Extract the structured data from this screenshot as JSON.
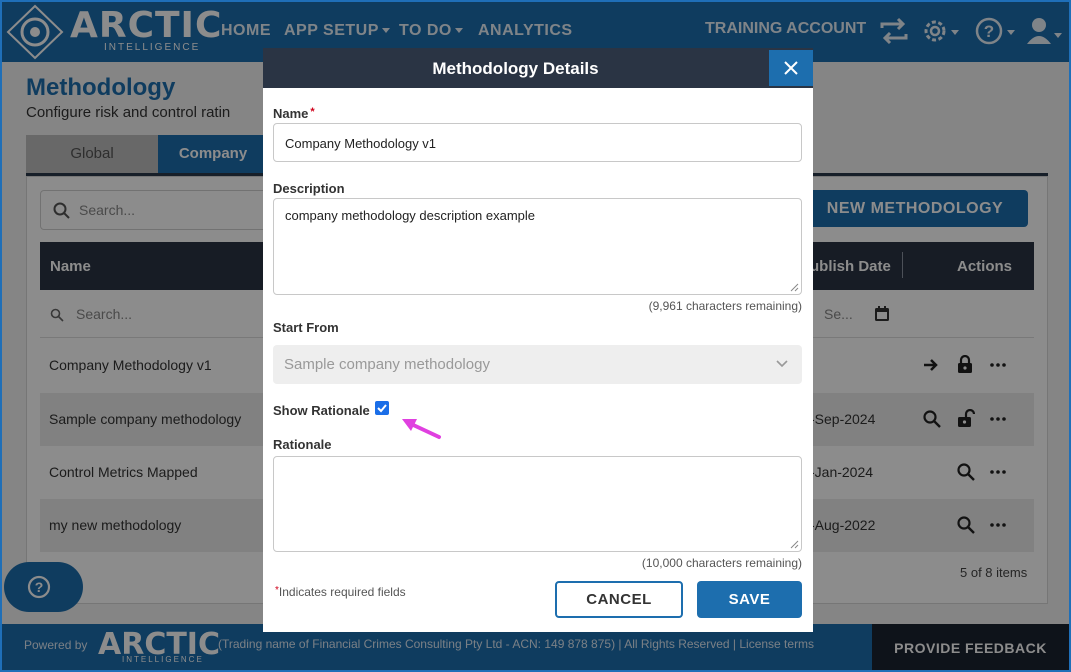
{
  "brand": {
    "name": "ARCTIC",
    "tagline": "INTELLIGENCE"
  },
  "nav": {
    "home": "HOME",
    "app_setup": "APP SETUP",
    "todo": "TO DO",
    "analytics": "ANALYTICS",
    "account": "TRAINING ACCOUNT"
  },
  "page": {
    "title": "Methodology",
    "subtitle": "Configure risk and control ratin",
    "tabs": [
      "Global",
      "Company"
    ],
    "search_placeholder": "Search...",
    "new_button": "NEW METHODOLOGY",
    "columns": {
      "name": "Name",
      "publish_date": "ublish Date",
      "actions": "Actions"
    },
    "filter_placeholder": "Search...",
    "date_filter_placeholder": "Se...",
    "rows": [
      {
        "name": "Company Methodology v1",
        "date": ""
      },
      {
        "name": "Sample company methodology",
        "date": "-Sep-2024"
      },
      {
        "name": "Control Metrics Mapped",
        "date": "-Jan-2024"
      },
      {
        "name": "my new methodology",
        "date": "-Aug-2022"
      }
    ],
    "items_count": "5 of 8 items"
  },
  "modal": {
    "title": "Methodology Details",
    "name_label": "Name",
    "required_mark": "*",
    "name_value": "Company Methodology v1",
    "description_label": "Description",
    "description_value": "company methodology description example",
    "description_remaining": "(9,961 characters remaining)",
    "start_from_label": "Start From",
    "start_from_value": "Sample company methodology",
    "show_rationale_label": "Show Rationale",
    "show_rationale_checked": true,
    "rationale_label": "Rationale",
    "rationale_value": "",
    "rationale_remaining": "(10,000 characters remaining)",
    "required_note_mark": "*",
    "required_note": "Indicates required fields",
    "cancel": "CANCEL",
    "save": "SAVE"
  },
  "footer": {
    "powered_by": "Powered by",
    "logo": "ARCTIC",
    "logo_sub": "INTELLIGENCE",
    "legal": "(Trading name of Financial Crimes Consulting Pty Ltd - ACN: 149 878 875)  |  All Rights Reserved  |  License terms",
    "feedback": "PROVIDE FEEDBACK"
  },
  "colors": {
    "primary": "#1d6eae",
    "dark": "#2a3444",
    "annotation_arrow": "#e040e0"
  }
}
